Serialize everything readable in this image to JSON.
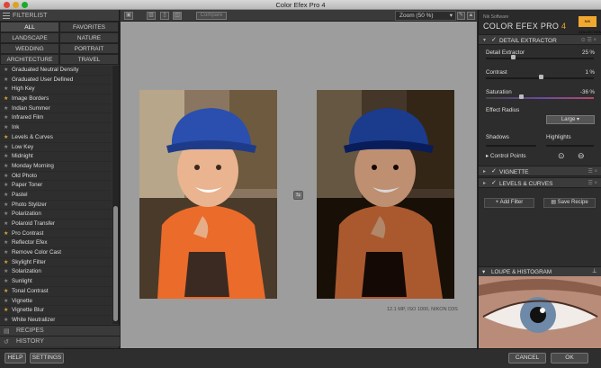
{
  "app": {
    "title": "Color Efex Pro 4"
  },
  "left_panel": {
    "header": "FILTERLIST",
    "categories": [
      "ALL",
      "FAVORITES",
      "LANDSCAPE",
      "NATURE",
      "WEDDING",
      "PORTRAIT",
      "ARCHITECTURE",
      "TRAVEL"
    ],
    "active_category": "ALL",
    "filters": [
      {
        "name": "Graduated Neutral Density",
        "favorite": false
      },
      {
        "name": "Graduated User Defined",
        "favorite": false
      },
      {
        "name": "High Key",
        "favorite": false
      },
      {
        "name": "Image Borders",
        "favorite": true
      },
      {
        "name": "Indian Summer",
        "favorite": false
      },
      {
        "name": "Infrared Film",
        "favorite": false
      },
      {
        "name": "Ink",
        "favorite": false
      },
      {
        "name": "Levels & Curves",
        "favorite": true
      },
      {
        "name": "Low Key",
        "favorite": false
      },
      {
        "name": "Midnight",
        "favorite": false
      },
      {
        "name": "Monday Morning",
        "favorite": false
      },
      {
        "name": "Old Photo",
        "favorite": false
      },
      {
        "name": "Paper Toner",
        "favorite": false
      },
      {
        "name": "Pastel",
        "favorite": false
      },
      {
        "name": "Photo Stylizer",
        "favorite": false
      },
      {
        "name": "Polarization",
        "favorite": false
      },
      {
        "name": "Polaroid Transfer",
        "favorite": false
      },
      {
        "name": "Pro Contrast",
        "favorite": true
      },
      {
        "name": "Reflector Efex",
        "favorite": false
      },
      {
        "name": "Remove Color Cast",
        "favorite": false
      },
      {
        "name": "Skylight Filter",
        "favorite": true
      },
      {
        "name": "Solarization",
        "favorite": false
      },
      {
        "name": "Sunlight",
        "favorite": false
      },
      {
        "name": "Tonal Contrast",
        "favorite": true
      },
      {
        "name": "Vignette",
        "favorite": false
      },
      {
        "name": "Vignette Blur",
        "favorite": true
      },
      {
        "name": "White Neutralizer",
        "favorite": false
      }
    ],
    "recipes": "RECIPES",
    "history": "HISTORY"
  },
  "toolbar": {
    "compare_label": "Compare",
    "zoom": "Zoom (50 %)"
  },
  "canvas": {
    "info": "12.1 MP, ISO 1000, NIKON D3S"
  },
  "right_panel": {
    "brand_small": "Nik Software",
    "brand_name": "COLOR EFEX PRO",
    "brand_version": "4",
    "badge": "NIK COLLECTION",
    "detail_section": "DETAIL EXTRACTOR",
    "params": [
      {
        "label": "Detail Extractor",
        "value": "25",
        "unit": "%",
        "level": 0.25
      },
      {
        "label": "Contrast",
        "value": "1",
        "unit": "%",
        "level": 0.5
      },
      {
        "label": "Saturation",
        "value": "-36",
        "unit": "%",
        "level": 0.32
      }
    ],
    "effect_radius_label": "Effect Radius",
    "effect_radius_value": "Large",
    "shadows_label": "Shadows",
    "highlights_label": "Highlights",
    "control_points": "Control Points",
    "vignette_section": "VIGNETTE",
    "levels_section": "LEVELS & CURVES",
    "add_filter": "Add Filter",
    "save_recipe": "Save Recipe",
    "loupe": "LOUPE & HISTOGRAM"
  },
  "bottom": {
    "help": "HELP",
    "settings": "SETTINGS",
    "cancel": "CANCEL",
    "ok": "OK"
  },
  "colors": {
    "accent": "#f0a830",
    "panel": "#2d2d2d",
    "canvas": "#9d9d9d",
    "favorite_star": "#d9a832"
  }
}
